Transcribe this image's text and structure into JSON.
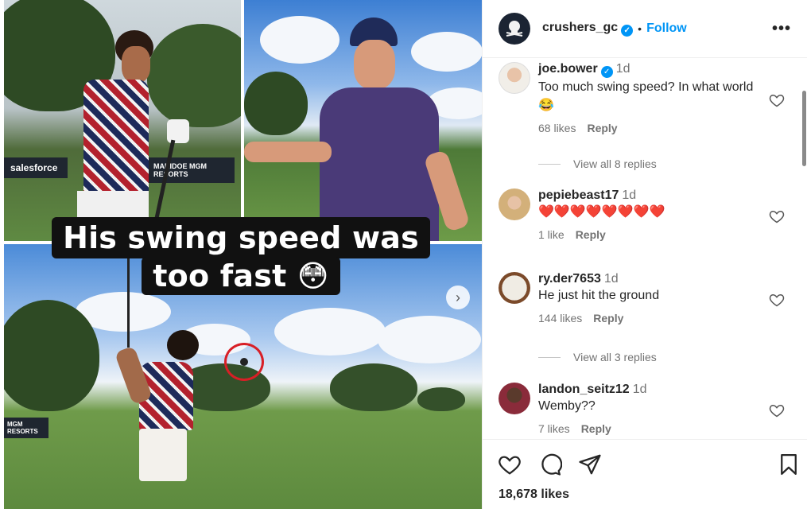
{
  "post": {
    "caption_line_1": "His swing speed was",
    "caption_line_2": "too fast 😳",
    "sign_salesforce": "salesforce",
    "sign_mgm_1": "MGM RESORTS",
    "sign_maridoe": "MARIDOE",
    "sign_mgm_2": "MGM RESORTS"
  },
  "header": {
    "username": "crushers_gc",
    "separator": "•",
    "follow_label": "Follow",
    "more_label": "•••"
  },
  "comments": [
    {
      "user": "joe.bower",
      "verified": true,
      "time": "1d",
      "text": "Too much swing speed? In what world 😂",
      "likes": "68 likes",
      "reply": "Reply",
      "view_replies": "View all 8 replies"
    },
    {
      "user": "pepiebeast17",
      "verified": false,
      "time": "1d",
      "text": "❤️❤️❤️❤️❤️❤️❤️❤️",
      "likes": "1 like",
      "reply": "Reply"
    },
    {
      "user": "ry.der7653",
      "verified": false,
      "time": "1d",
      "text": "He just hit the ground",
      "likes": "144 likes",
      "reply": "Reply",
      "view_replies": "View all 3 replies"
    },
    {
      "user": "landon_seitz12",
      "verified": false,
      "time": "1d",
      "text": "Wemby??",
      "likes": "7 likes",
      "reply": "Reply"
    }
  ],
  "footer": {
    "likes_count": "18,678 likes"
  },
  "icons": {
    "like": "heart-icon",
    "comment": "comment-icon",
    "share": "send-icon",
    "save": "bookmark-icon",
    "next": "chevron-right-icon"
  },
  "colors": {
    "accent": "#0095f6",
    "caption_bg": "#111111",
    "ball_circle": "#d81f26"
  }
}
